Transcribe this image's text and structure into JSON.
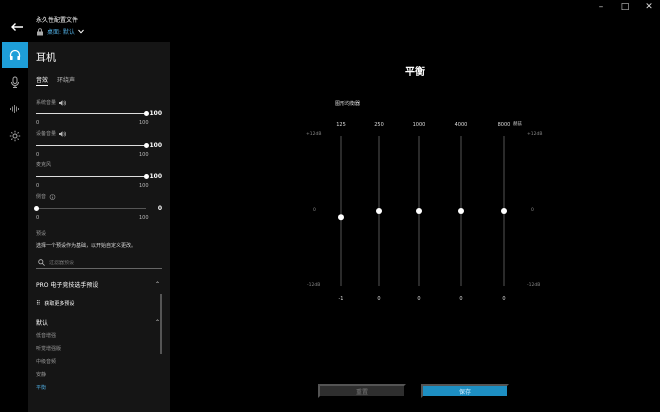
{
  "window": {
    "min": "–",
    "max": "□",
    "close": "✕"
  },
  "header": {
    "profile_label": "永久性配置文件",
    "profile_name": "桌面: 默认"
  },
  "sidebar": {
    "items": [
      "headphones-icon",
      "mic-icon",
      "equalizer-icon",
      "lighting-icon"
    ],
    "active": 0
  },
  "panel": {
    "title": "耳机",
    "tabs": [
      "音效",
      "环绕声"
    ],
    "active_tab": 0,
    "controls": [
      {
        "label": "系统音量",
        "value": "100",
        "min": "0",
        "max": "100",
        "level": 1.0,
        "icon": "speaker-icon"
      },
      {
        "label": "设备音量",
        "value": "100",
        "min": "0",
        "max": "100",
        "level": 1.0,
        "icon": "speaker-icon"
      },
      {
        "label": "麦克风",
        "value": "100",
        "min": "0",
        "max": "100",
        "level": 1.0,
        "icon": ""
      },
      {
        "label": "侧音",
        "value": "0",
        "min": "0",
        "max": "100",
        "level": 0.0,
        "icon": "info-icon"
      }
    ],
    "preset_heading": "预设",
    "preset_desc": "选择一个预设作为基础，以开始自定义更改。",
    "search_placeholder": "过滤器预设",
    "group_pro": "PRO 电子竞技选手预设",
    "get_more": "获取更多预设",
    "group_default": "默认",
    "presets": [
      "低音增强",
      "听觉增强版",
      "中级音频",
      "安静",
      "平衡"
    ],
    "selected_preset": "平衡"
  },
  "main": {
    "title": "平衡",
    "eq_label": "图形均衡器",
    "db_top": "+12dB",
    "db_mid": "0",
    "db_bottom": "-12dB",
    "bass_label": "赫兹",
    "bands": [
      {
        "freq": "125",
        "value": -1
      },
      {
        "freq": "250",
        "value": 0
      },
      {
        "freq": "1000",
        "value": 0
      },
      {
        "freq": "4000",
        "value": 0
      },
      {
        "freq": "8000",
        "value": 0
      }
    ],
    "reset": "重置",
    "save": "保存"
  },
  "colors": {
    "accent": "#1e9ed8",
    "panel": "#151515",
    "background": "#000000"
  }
}
